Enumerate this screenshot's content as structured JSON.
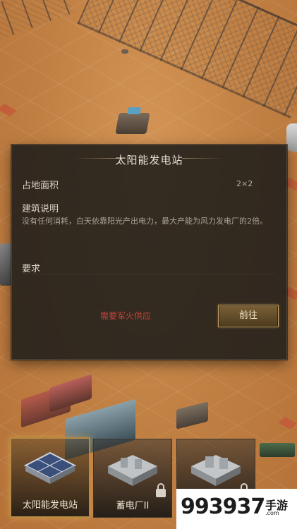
{
  "dialog": {
    "title": "太阳能发电站",
    "area_label": "占地面积",
    "area_value": "2×2",
    "desc_label": "建筑说明",
    "desc_text": "没有任何消耗，白天依靠阳光产出电力，最大产能为风力发电厂的2倍。",
    "require_label": "要求",
    "warning": "需要军火供应",
    "go_button": "前往"
  },
  "cards": [
    {
      "label": "太阳能发电站",
      "selected": true,
      "locked": false
    },
    {
      "label": "蓄电厂II",
      "selected": false,
      "locked": true
    },
    {
      "label": "",
      "selected": false,
      "locked": true
    }
  ],
  "watermark": {
    "number": "993937",
    "brand": "手游",
    "url": ".com"
  },
  "colors": {
    "accent_gold": "#b58a45",
    "warning_red": "#c0443c",
    "dialog_bg": "#1e1c1a"
  }
}
